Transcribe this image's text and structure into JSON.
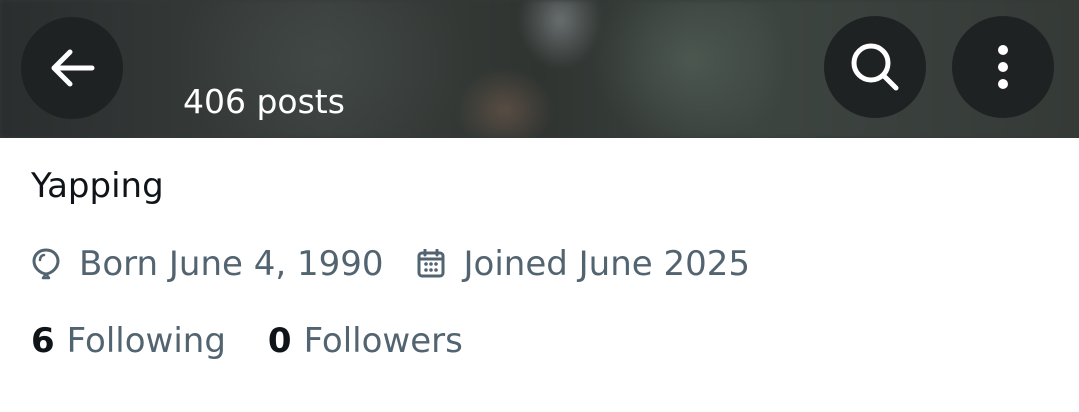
{
  "header": {
    "posts_count": "406 posts",
    "back_icon": "arrow-left-icon",
    "search_icon": "search-icon",
    "more_icon": "more-vertical-icon",
    "button_color": "#1f2222"
  },
  "profile": {
    "bio": "Yapping",
    "birthday": "Born June 4, 1990",
    "birthday_icon": "balloon-icon",
    "joined": "Joined June 2025",
    "joined_icon": "calendar-icon",
    "following_count": "6",
    "following_label": "Following",
    "followers_count": "0",
    "followers_label": "Followers"
  },
  "colors": {
    "primary_text": "#0f1419",
    "secondary_text": "#536471",
    "background": "#ffffff"
  }
}
